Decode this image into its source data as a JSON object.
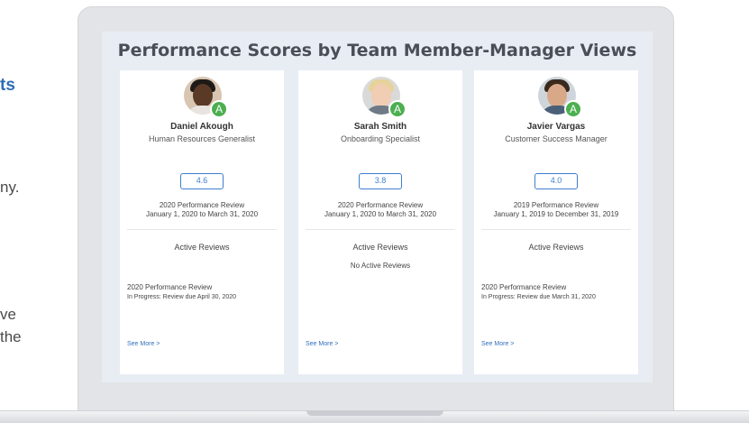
{
  "background": {
    "accent_fragment": "ts",
    "line1": "ny.",
    "line2": "ve",
    "line3": "the"
  },
  "screen": {
    "title": "Performance Scores by Team Member-Manager Views"
  },
  "cards": [
    {
      "name": "Daniel Akough",
      "role": "Human Resources Generalist",
      "badge": "A",
      "score": "4.6",
      "review_title": "2020 Performance Review",
      "review_dates": "January 1, 2020 to March 31, 2020",
      "active_header": "Active Reviews",
      "no_active": "",
      "item_title": "2020 Performance Review",
      "item_status": "In Progress: Review due April 30, 2020",
      "see_more": "See More >"
    },
    {
      "name": "Sarah Smith",
      "role": "Onboarding Specialist",
      "badge": "A",
      "score": "3.8",
      "review_title": "2020 Performance Review",
      "review_dates": "January 1, 2020 to March 31, 2020",
      "active_header": "Active Reviews",
      "no_active": "No Active Reviews",
      "item_title": "",
      "item_status": "",
      "see_more": "See More >"
    },
    {
      "name": "Javier Vargas",
      "role": "Customer Success Manager",
      "badge": "A",
      "score": "4.0",
      "review_title": "2019 Performance Review",
      "review_dates": "January 1, 2019 to December 31, 2019",
      "active_header": "Active Reviews",
      "no_active": "",
      "item_title": "2020 Performance Review",
      "item_status": "In Progress: Review due March 31, 2020",
      "see_more": "See More >"
    }
  ],
  "colors": {
    "accent": "#2e6db4",
    "score_border": "#3f7fd0",
    "badge": "#4caf50",
    "screen_bg": "#e8edf4"
  },
  "icons": [
    "avatar-photo",
    "status-badge-a"
  ]
}
